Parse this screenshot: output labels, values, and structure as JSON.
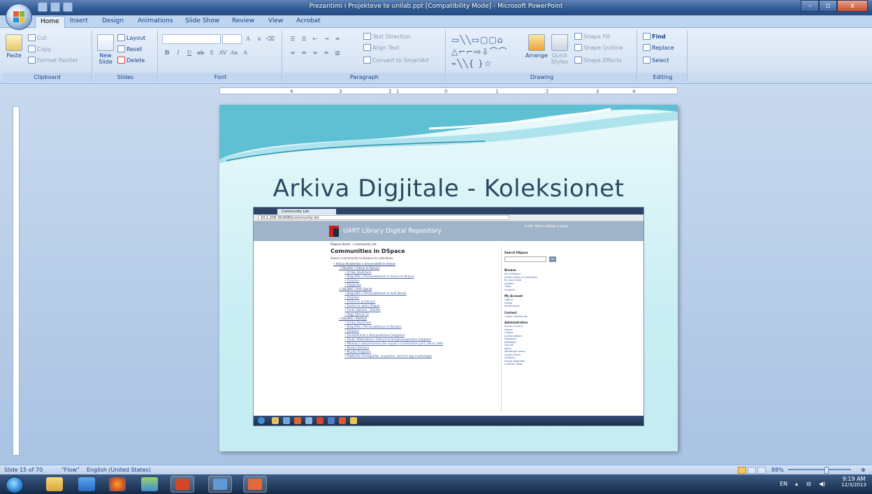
{
  "window": {
    "title": "Prezantimi i Projekteve te unilab.ppt [Compatibility Mode] - Microsoft PowerPoint",
    "min": "–",
    "max": "▫",
    "close": "x"
  },
  "tabs": [
    "Home",
    "Insert",
    "Design",
    "Animations",
    "Slide Show",
    "Review",
    "View",
    "Acrobat"
  ],
  "ribbon": {
    "clipboard": {
      "paste": "Paste",
      "cut": "Cut",
      "copy": "Copy",
      "format_painter": "Format Painter",
      "label": "Clipboard"
    },
    "slides": {
      "new_slide": "New Slide",
      "layout": "Layout",
      "reset": "Reset",
      "delete": "Delete",
      "label": "Slides"
    },
    "font": {
      "label": "Font"
    },
    "paragraph": {
      "text_direction": "Text Direction",
      "align_text": "Align Text",
      "convert": "Convert to SmartArt",
      "label": "Paragraph"
    },
    "drawing": {
      "arrange": "Arrange",
      "quick_styles": "Quick Styles",
      "shape_fill": "Shape Fill",
      "shape_outline": "Shape Outline",
      "shape_effects": "Shape Effects",
      "label": "Drawing"
    },
    "editing": {
      "find": "Find",
      "replace": "Replace",
      "select": "Select",
      "label": "Editing"
    }
  },
  "ruler": {
    "h_labels": [
      "4",
      "3",
      "2",
      "1",
      "0",
      "1",
      "2",
      "3",
      "4"
    ]
  },
  "slide": {
    "title": "Arkiva Digjitale - Koleksionet",
    "screenshot": {
      "tab": "Community List",
      "url": "10.1.208.39:8080/community-list",
      "site_name": "UART Library Digital Repository",
      "login": "Profile: Medine Dëllaqi | Logout",
      "breadcrumb": "DSpace Home → Community List",
      "heading": "Communities in DSpace",
      "subtext": "Select a community to browse its collections.",
      "tree": [
        {
          "lvl": 1,
          "text": "Arkiva Akademike e Universitetit te Arteve"
        },
        {
          "lvl": 2,
          "text": "Fakulteti i Arteve te Bukura"
        },
        {
          "lvl": 3,
          "text": "Artikuj Studimore"
        },
        {
          "lvl": 3,
          "text": "Biografite e Personaliteteve te Arteve te Bukura"
        },
        {
          "lvl": 3,
          "text": "Disiplina"
        },
        {
          "lvl": 3,
          "text": "Diagonika"
        },
        {
          "lvl": 2,
          "text": "Fakulteti i Artit Skenik"
        },
        {
          "lvl": 3,
          "text": "Biografite e Personaliteteve te Artit Skenik"
        },
        {
          "lvl": 3,
          "text": "Disiplina"
        },
        {
          "lvl": 3,
          "text": "Drama te prodhuara"
        },
        {
          "lvl": 3,
          "text": "Drama te vjetra Shqipe"
        },
        {
          "lvl": 3,
          "text": "Fonte diploma - Skenike"
        },
        {
          "lvl": 3,
          "text": "Regji Filmi & TV"
        },
        {
          "lvl": 2,
          "text": "Fakulteti i Muzikes"
        },
        {
          "lvl": 3,
          "text": "Artikuj Studimore"
        },
        {
          "lvl": 3,
          "text": "Biografite e Personaliteteve te Muzikes"
        },
        {
          "lvl": 3,
          "text": "Disiplina"
        },
        {
          "lvl": 3,
          "text": "Dorezhkrimet e Kompozitoreve Shqiptare"
        },
        {
          "lvl": 3,
          "text": "Fondi i Materialeve i shkruar te kengeve popullore shqiptare"
        },
        {
          "lvl": 3,
          "text": "Mbledja e dokumenteve dhe veprat e muzikanteve para vitevë 1990"
        },
        {
          "lvl": 3,
          "text": "Muzika Etnikore"
        },
        {
          "lvl": 3,
          "text": "Muzika Shqiptare"
        },
        {
          "lvl": 3,
          "text": "Publikime monografike, arsyetime, shkrime nga muzikologet"
        }
      ],
      "sidebar": [
        {
          "h": "Search DSpace",
          "items": []
        },
        {
          "h": "Browse",
          "items": [
            "All of DSpace",
            "Communities & Collections",
            "By Issue Date",
            "Authors",
            "Titles",
            "Subjects"
          ]
        },
        {
          "h": "My Account",
          "items": [
            "Logout",
            "Profile",
            "Submissions"
          ]
        },
        {
          "h": "Context",
          "items": [
            "Create Community"
          ]
        },
        {
          "h": "Administrative",
          "items": [
            "Access Control",
            "People",
            "Groups",
            "Authorizations",
            "Registries",
            "Metadata",
            "Format",
            "Items",
            "Withdrawn Items",
            "Control Panel",
            "Statistics",
            "Import Metadata",
            "Curation Tasks"
          ]
        }
      ],
      "go": "Go"
    }
  },
  "status": {
    "slide": "Slide 15 of 70",
    "theme": "\"Flow\"",
    "language": "English (United States)",
    "zoom": "88%"
  },
  "taskbar": {
    "lang": "EN",
    "time": "9:19 AM",
    "date": "12/3/2013"
  }
}
